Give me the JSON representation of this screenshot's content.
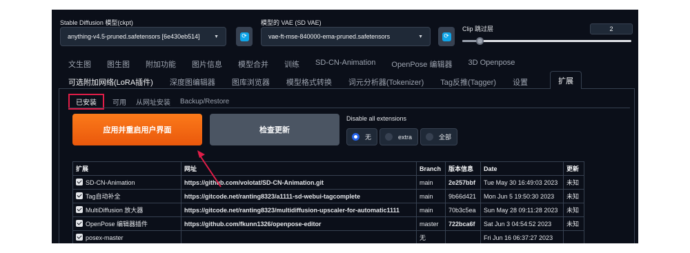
{
  "model_select": {
    "label": "Stable Diffusion 模型(ckpt)",
    "value": "anything-v4.5-pruned.safetensors [6e430eb514]"
  },
  "vae_select": {
    "label": "模型的 VAE (SD VAE)",
    "value": "vae-ft-mse-840000-ema-pruned.safetensors"
  },
  "clip_skip": {
    "label": "Clip 跳过层",
    "value": "2",
    "level_fraction": 0.1
  },
  "tabs_row1": [
    "文生图",
    "图生图",
    "附加功能",
    "图片信息",
    "模型合并",
    "训练",
    "SD-CN-Animation",
    "OpenPose 编辑器",
    "3D Openpose"
  ],
  "tabs_row2": [
    "可选附加网络(LoRA插件)",
    "深度图编辑器",
    "图库浏览器",
    "模型格式转换",
    "词元分析器(Tokenizer)",
    "Tag反推(Tagger)",
    "设置"
  ],
  "active_tab": "扩展",
  "sub_tabs": [
    "已安装",
    "可用",
    "从网址安装",
    "Backup/Restore"
  ],
  "buttons": {
    "apply_restart": "应用并重启用户界面",
    "check_updates": "检查更新"
  },
  "disable_extensions": {
    "label": "Disable all extensions",
    "options": [
      "无",
      "extra",
      "全部"
    ],
    "selected": "无"
  },
  "table": {
    "headers": [
      "扩展",
      "网址",
      "Branch",
      "版本信息",
      "Date",
      "更新"
    ],
    "rows": [
      {
        "name": "SD-CN-Animation",
        "url": "https://github.com/volotat/SD-CN-Animation.git",
        "branch": "main",
        "version": "2e257bbf",
        "date": "Tue May 30 16:49:03 2023",
        "update": "未知",
        "checked": true
      },
      {
        "name": "Tag自动补全",
        "url": "https://gitcode.net/ranting8323/a1111-sd-webui-tagcomplete",
        "branch": "main",
        "version": "9b66d421",
        "date": "Mon Jun 5 19:50:30 2023",
        "update": "未知",
        "checked": true
      },
      {
        "name": "MultiDiffusion 放大器",
        "url": "https://gitcode.net/ranting8323/multidiffusion-upscaler-for-automatic1111",
        "branch": "main",
        "version": "70b3c5ea",
        "date": "Sun May 28 09:11:28 2023",
        "update": "未知",
        "checked": true
      },
      {
        "name": "OpenPose 编辑器插件",
        "url": "https://github.com/fkunn1326/openpose-editor",
        "branch": "master",
        "version": "722bca6f",
        "date": "Sat Jun 3 04:54:52 2023",
        "update": "未知",
        "checked": true
      },
      {
        "name": "posex-master",
        "url": "",
        "branch": "无",
        "version": "",
        "date": "Fri Jun 16 06:37:27 2023",
        "update": "",
        "checked": true
      }
    ]
  },
  "colors": {
    "panel_bg": "#0b0f19",
    "primary_button": "#ea580c",
    "annotation_red": "#e11d48",
    "radio_accent": "#2563eb"
  }
}
